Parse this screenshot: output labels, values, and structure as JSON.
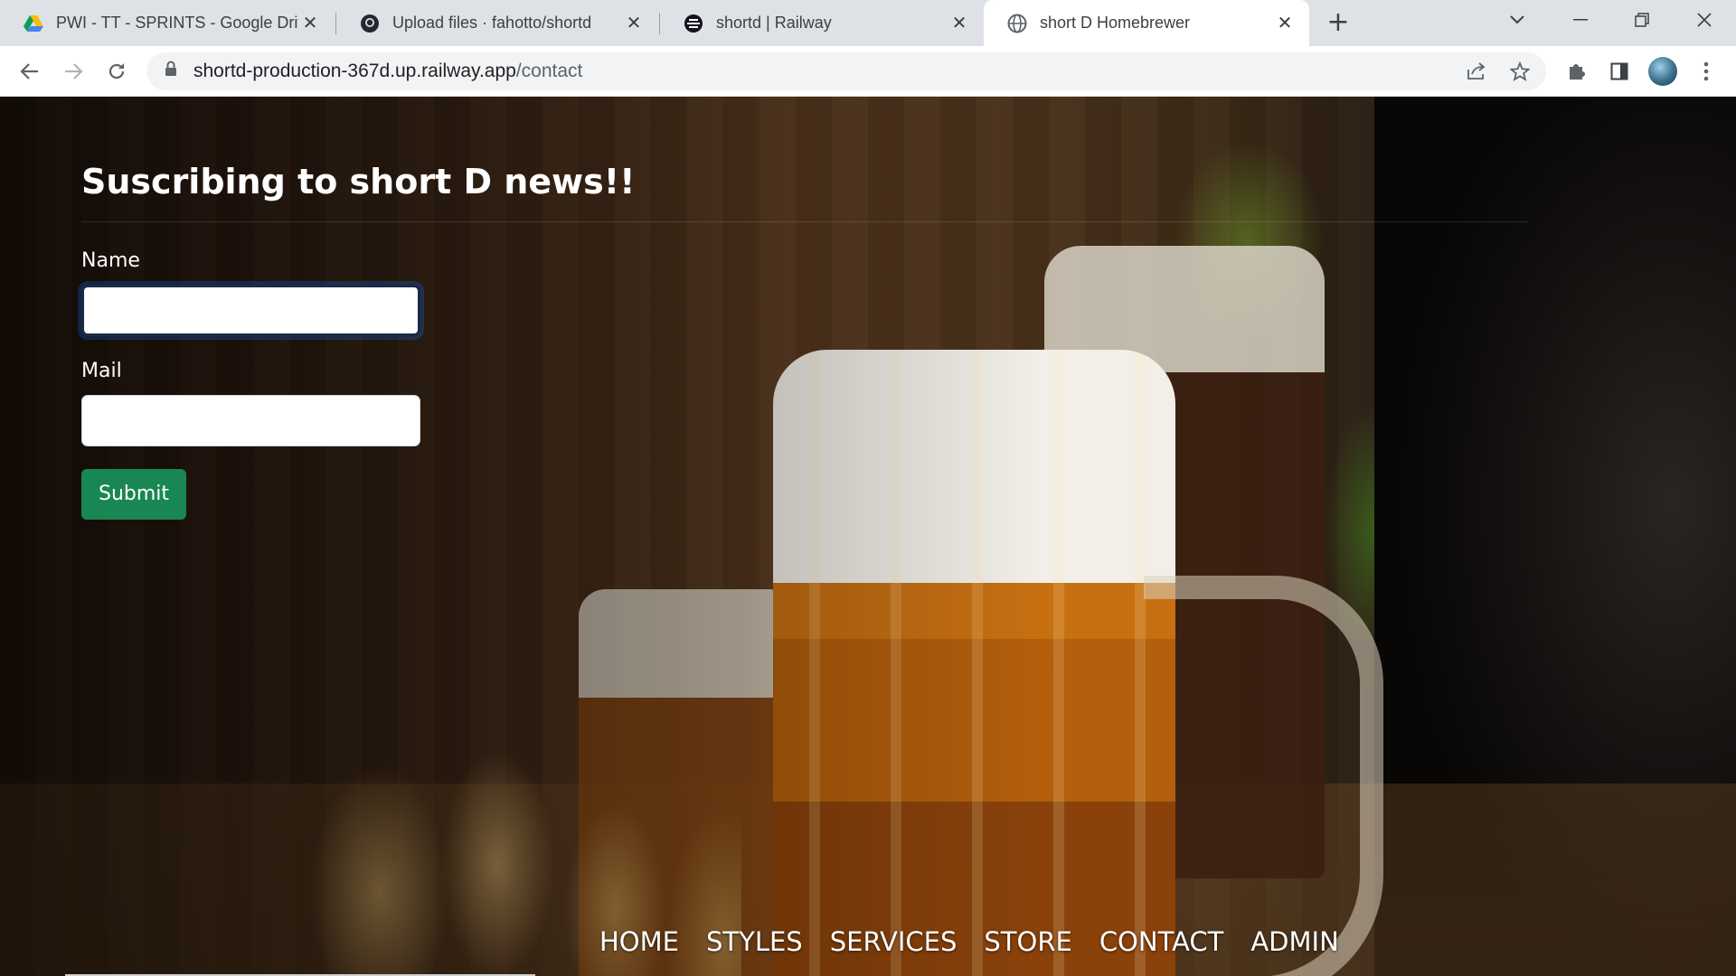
{
  "browser": {
    "tabs": [
      {
        "title": "PWI - TT - SPRINTS - Google Driv",
        "icon": "google-drive-icon",
        "active": false
      },
      {
        "title": "Upload files · fahotto/shortd",
        "icon": "github-icon",
        "active": false
      },
      {
        "title": "shortd | Railway",
        "icon": "railway-icon",
        "active": false
      },
      {
        "title": "short D Homebrewer",
        "icon": "globe-icon",
        "active": true
      }
    ],
    "url_host": "shortd-production-367d.up.railway.app",
    "url_path": "/contact"
  },
  "page": {
    "title": "Suscribing to short D news!!",
    "form": {
      "name_label": "Name",
      "name_value": "",
      "mail_label": "Mail",
      "mail_value": "",
      "submit_label": "Submit"
    },
    "nav": [
      "HOME",
      "STYLES",
      "SERVICES",
      "STORE",
      "CONTACT",
      "ADMIN"
    ]
  },
  "colors": {
    "tabstrip_bg": "#dee1e6",
    "submit_bg": "#198754",
    "focus_border": "#1b2a4a"
  }
}
